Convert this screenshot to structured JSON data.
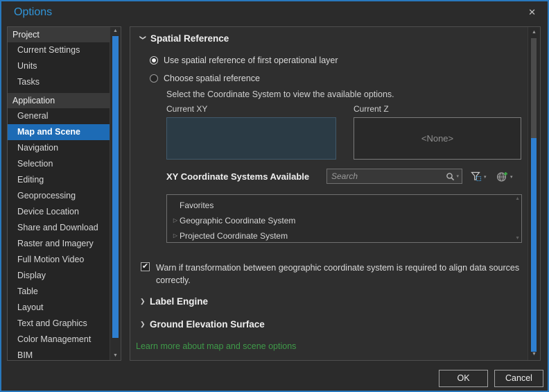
{
  "window": {
    "title": "Options",
    "close_glyph": "✕"
  },
  "sidebar": {
    "selected_item": "Map and Scene",
    "sections": [
      {
        "header": "Project",
        "items": [
          "Current Settings",
          "Units",
          "Tasks"
        ]
      },
      {
        "header": "Application",
        "items": [
          "General",
          "Map and Scene",
          "Navigation",
          "Selection",
          "Editing",
          "Geoprocessing",
          "Device Location",
          "Share and Download",
          "Raster and Imagery",
          "Full Motion Video",
          "Display",
          "Table",
          "Layout",
          "Text and Graphics",
          "Color Management",
          "BIM"
        ]
      }
    ]
  },
  "main": {
    "spatial_reference": {
      "title": "Spatial Reference",
      "radio_use_first": "Use spatial reference of first operational layer",
      "radio_choose": "Choose spatial reference",
      "instruction": "Select the Coordinate System to view the available options.",
      "current_xy_label": "Current XY",
      "current_z_label": "Current Z",
      "current_z_value": "<None>",
      "available_label": "XY Coordinate Systems Available",
      "search_placeholder": "Search",
      "tree": [
        "Favorites",
        "Geographic Coordinate System",
        "Projected Coordinate System"
      ],
      "warn_label": "Warn if transformation between geographic coordinate system is required to align data sources correctly."
    },
    "label_engine_title": "Label Engine",
    "ground_elevation_title": "Ground Elevation Surface",
    "learn_more": "Learn more about map and scene options"
  },
  "footer": {
    "ok": "OK",
    "cancel": "Cancel"
  },
  "colors": {
    "dialog_border": "#2878bd",
    "title_blue": "#3095d9",
    "selection_blue": "#1d6bb5",
    "scrollbar_blue": "#2e7fd0",
    "link_green": "#3f9b49",
    "current_xy_fill": "#2b3b45"
  }
}
